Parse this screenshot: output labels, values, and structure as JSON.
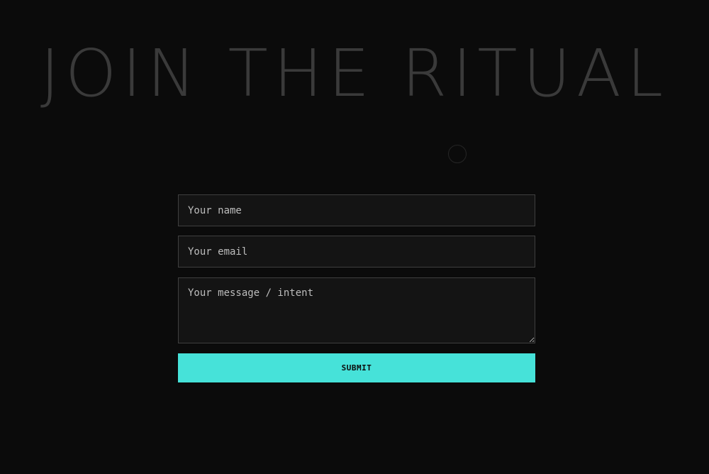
{
  "hero": {
    "title": "JOIN THE RITUAL"
  },
  "form": {
    "name_placeholder": "Your name",
    "email_placeholder": "Your email",
    "message_placeholder": "Your message / intent",
    "submit_label": "SUBMIT"
  },
  "colors": {
    "background": "#0b0b0b",
    "accent": "#46e2d9",
    "title": "#3a3a3a",
    "field_bg": "#141414",
    "field_border": "#3f3f3f"
  },
  "icons": {
    "ring": "circle-outline-icon"
  }
}
